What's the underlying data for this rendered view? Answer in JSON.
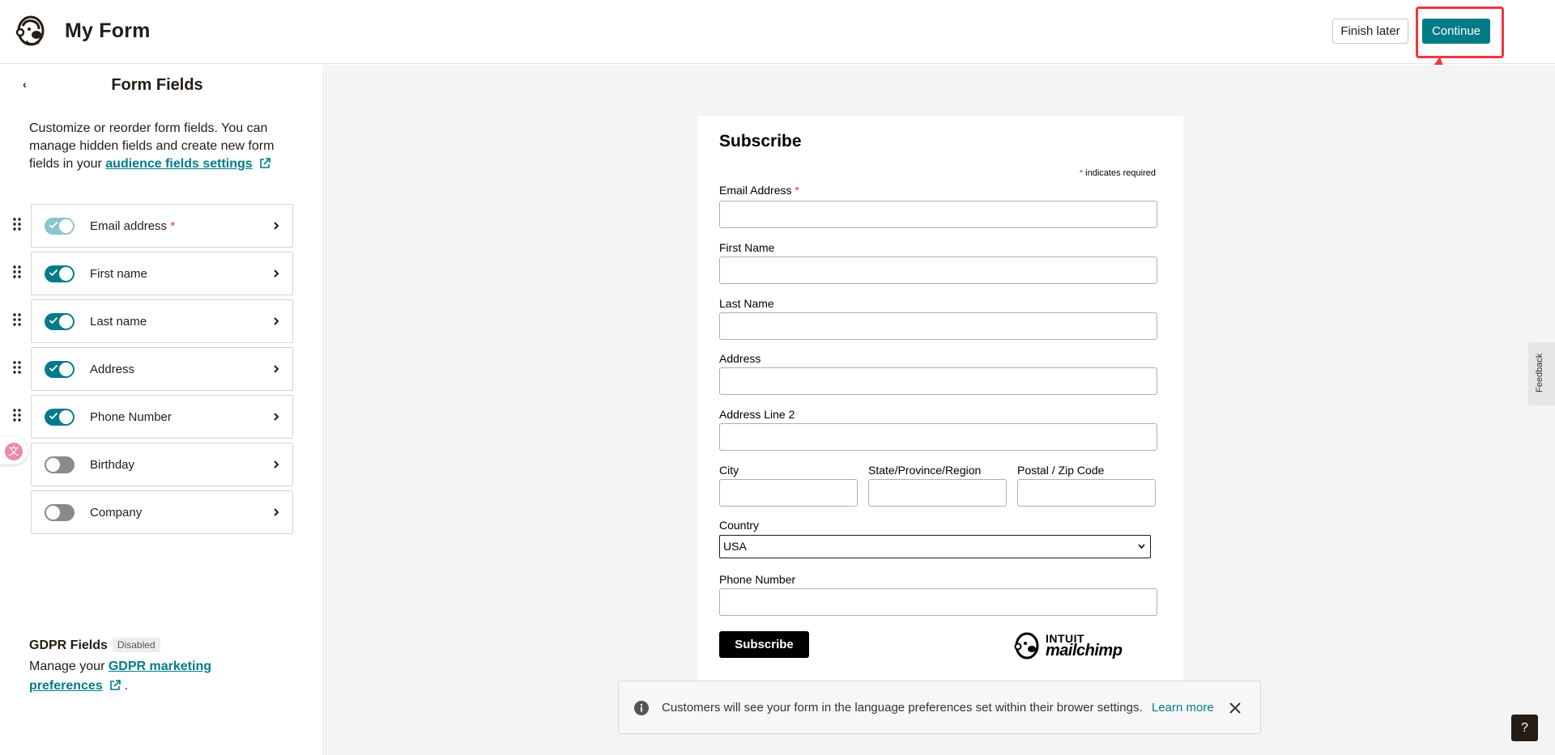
{
  "header": {
    "title": "My Form",
    "finish_later": "Finish later",
    "continue": "Continue"
  },
  "left_panel": {
    "back": "‹",
    "title": "Form Fields",
    "desc_text": "Customize or reorder form fields. You can manage hidden fields and create new form fields in your",
    "desc_link": "audience fields settings",
    "fields": [
      {
        "label": "Email address",
        "state": "locked",
        "required": "*"
      },
      {
        "label": "First name",
        "state": "on"
      },
      {
        "label": "Last name",
        "state": "on"
      },
      {
        "label": "Address",
        "state": "on"
      },
      {
        "label": "Phone Number",
        "state": "on"
      },
      {
        "label": "Birthday",
        "state": "off"
      },
      {
        "label": "Company",
        "state": "off"
      }
    ],
    "gdpr_title": "GDPR Fields",
    "gdpr_badge": "Disabled",
    "gdpr_desc_text": "Manage your",
    "gdpr_link": "GDPR marketing preferences",
    "gdpr_end": "."
  },
  "form_preview": {
    "title": "Subscribe",
    "required_star": "*",
    "required_note": "indicates required",
    "email_label": "Email Address",
    "email_star": "*",
    "first_name_label": "First Name",
    "last_name_label": "Last Name",
    "address_label": "Address",
    "address2_label": "Address Line 2",
    "city_label": "City",
    "state_label": "State/Province/Region",
    "zip_label": "Postal / Zip Code",
    "country_label": "Country",
    "country_value": "USA",
    "phone_label": "Phone Number",
    "subscribe_button": "Subscribe",
    "brand_top": "INTUIT",
    "brand_bottom": "mailchimp"
  },
  "toast": {
    "text": "Customers will see your form in the language preferences set within their brower settings.",
    "link": "Learn more"
  },
  "feedback": "Feedback",
  "help": "?",
  "colors": {
    "accent": "#007c89",
    "highlight": "#f2353d",
    "required": "#d92d2d"
  }
}
